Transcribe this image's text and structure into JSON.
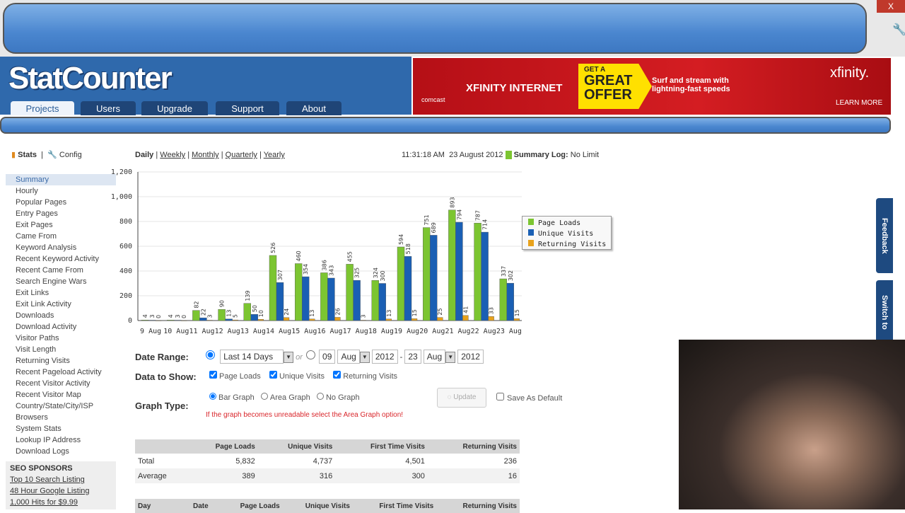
{
  "browser": {
    "close_label": "X"
  },
  "header": {
    "logo": "StatCounter",
    "tabs": [
      "Projects",
      "Users",
      "Upgrade",
      "Support",
      "About"
    ],
    "active_tab": 0
  },
  "ad": {
    "title": "XFINITY INTERNET",
    "badge_line1": "GET A",
    "badge_line2": "GREAT",
    "badge_line3": "OFFER",
    "tagline": "Surf and stream with lightning-fast speeds",
    "brand": "xfinity.",
    "cta": "LEARN MORE",
    "sponsor": "comcast"
  },
  "toolbar": {
    "stats": "Stats",
    "config": "Config",
    "periods": [
      "Daily",
      "Weekly",
      "Monthly",
      "Quarterly",
      "Yearly"
    ],
    "time": "11:31:18 AM",
    "date": "23 August 2012",
    "summary_log_label": "Summary Log:",
    "summary_log_value": "No Limit"
  },
  "sidebar": {
    "items": [
      "Summary",
      "Hourly",
      "Popular Pages",
      "Entry Pages",
      "Exit Pages",
      "Came From",
      "Keyword Analysis",
      "Recent Keyword Activity",
      "Recent Came From",
      "Search Engine Wars",
      "Exit Links",
      "Exit Link Activity",
      "Downloads",
      "Download Activity",
      "Visitor Paths",
      "Visit Length",
      "Returning Visits",
      "Recent Pageload Activity",
      "Recent Visitor Activity",
      "Recent Visitor Map",
      "Country/State/City/ISP",
      "Browsers",
      "System Stats",
      "Lookup IP Address",
      "Download Logs"
    ],
    "sponsors_title": "SEO SPONSORS",
    "sponsors": [
      "Top 10 Search Listing",
      "48 Hour Google Listing",
      "1,000 Hits for $9.99"
    ]
  },
  "chart_data": {
    "type": "bar",
    "title": "",
    "xlabel": "",
    "ylabel": "",
    "ylim": [
      0,
      1200
    ],
    "yticks": [
      "0",
      "200",
      "400",
      "600",
      "800",
      "1,000",
      "1,200"
    ],
    "categories": [
      "9 Aug",
      "10 Aug",
      "11 Aug",
      "12 Aug",
      "13 Aug",
      "14 Aug",
      "15 Aug",
      "16 Aug",
      "17 Aug",
      "18 Aug",
      "19 Aug",
      "20 Aug",
      "21 Aug",
      "22 Aug",
      "23 Aug"
    ],
    "series": [
      {
        "name": "Page Loads",
        "color": "#7cc531",
        "values": [
          4,
          4,
          82,
          90,
          139,
          526,
          460,
          386,
          455,
          324,
          594,
          751,
          893,
          787,
          337
        ]
      },
      {
        "name": "Unique Visits",
        "color": "#1a5fb4",
        "values": [
          3,
          3,
          22,
          13,
          50,
          307,
          354,
          343,
          325,
          300,
          518,
          689,
          794,
          714,
          302
        ]
      },
      {
        "name": "Returning Visits",
        "color": "#e8a21c",
        "values": [
          0,
          0,
          3,
          5,
          10,
          24,
          13,
          26,
          3,
          13,
          15,
          25,
          41,
          33,
          15
        ]
      }
    ],
    "legend": "right",
    "grid": true
  },
  "form": {
    "date_range_label": "Date Range:",
    "range_option": "Last 14 Days",
    "or": "or",
    "from_day": "09",
    "from_month": "Aug",
    "from_year": "2012",
    "dash": "-",
    "to_day": "23",
    "to_month": "Aug",
    "to_year": "2012",
    "data_label": "Data to Show:",
    "data_options": [
      "Page Loads",
      "Unique Visits",
      "Returning Visits"
    ],
    "graph_label": "Graph Type:",
    "graph_options": [
      "Bar Graph",
      "Area Graph",
      "No Graph"
    ],
    "update": "Update",
    "save_default": "Save As Default",
    "warning": "If the graph becomes unreadable select the Area Graph option!"
  },
  "summary": {
    "headers": [
      "",
      "Page Loads",
      "Unique Visits",
      "First Time Visits",
      "Returning Visits"
    ],
    "rows": [
      [
        "Total",
        "5,832",
        "4,737",
        "4,501",
        "236"
      ],
      [
        "Average",
        "389",
        "316",
        "300",
        "16"
      ]
    ]
  },
  "detail": {
    "headers": [
      "Day",
      "Date",
      "Page Loads",
      "Unique Visits",
      "First Time Visits",
      "Returning Visits"
    ]
  },
  "side_tabs": [
    "Feedback",
    "Switch to"
  ]
}
